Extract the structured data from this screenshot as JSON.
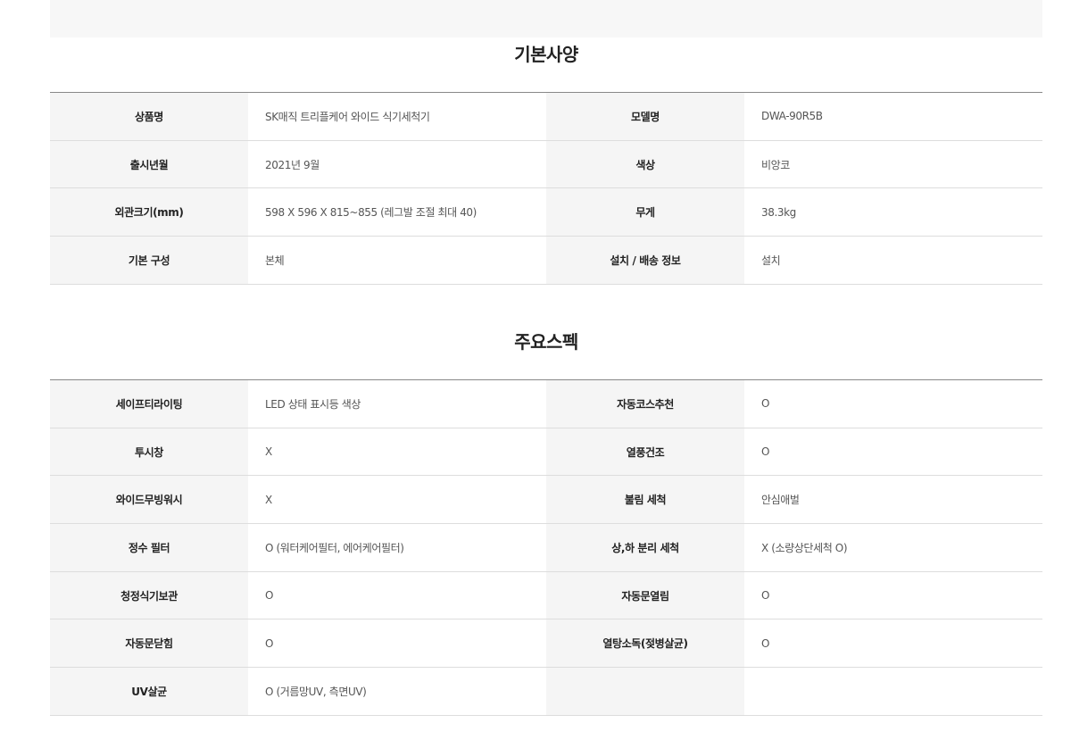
{
  "basic": {
    "title": "기본사양",
    "rows": [
      {
        "l1": "상품명",
        "v1": "SK매직 트리플케어 와이드 식기세척기",
        "l2": "모델명",
        "v2": "DWA-90R5B"
      },
      {
        "l1": "출시년월",
        "v1": "2021년 9월",
        "l2": "색상",
        "v2": "비앙코"
      },
      {
        "l1": "외관크기(mm)",
        "v1": "598 X 596 X 815~855 (레그발 조절 최대 40)",
        "l2": "무게",
        "v2": "38.3kg"
      },
      {
        "l1": "기본 구성",
        "v1": "본체",
        "l2": "설치 / 배송 정보",
        "v2": "설치"
      }
    ]
  },
  "main": {
    "title": "주요스펙",
    "rows": [
      {
        "l1": "세이프티라이팅",
        "v1": "LED 상태 표시등 색상",
        "l2": "자동코스추천",
        "v2": "O"
      },
      {
        "l1": "투시창",
        "v1": "X",
        "l2": "열풍건조",
        "v2": "O"
      },
      {
        "l1": "와이드무빙워시",
        "v1": "X",
        "l2": "불림 세척",
        "v2": "안심애벌"
      },
      {
        "l1": "정수 필터",
        "v1": "O (워터케어필터, 에어케어필터)",
        "l2": "상,하 분리 세척",
        "v2": "X (소량상단세척 O)"
      },
      {
        "l1": "청정식기보관",
        "v1": "O",
        "l2": "자동문열림",
        "v2": "O"
      },
      {
        "l1": "자동문닫힘",
        "v1": "O",
        "l2": "열탕소독(젖병살균)",
        "v2": "O"
      },
      {
        "l1": "UV살균",
        "v1": "O (거름망UV, 측면UV)",
        "l2": "",
        "v2": ""
      }
    ]
  }
}
